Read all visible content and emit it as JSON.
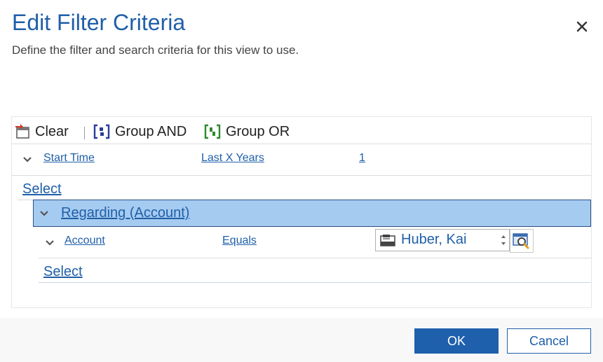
{
  "dialog": {
    "title": "Edit Filter Criteria",
    "subtitle": "Define the filter and search criteria for this view to use.",
    "close_icon": "close-icon"
  },
  "toolbar": {
    "clear_label": "Clear",
    "group_and_label": "Group AND",
    "group_or_label": "Group OR"
  },
  "conditions": [
    {
      "field": "Start Time",
      "operator": "Last X Years",
      "value": "1"
    }
  ],
  "select_label": "Select",
  "group": {
    "label": "Regarding (Account)",
    "condition": {
      "field": "Account",
      "operator": "Equals",
      "value": "Huber, Kai"
    },
    "select_label": "Select"
  },
  "footer": {
    "ok_label": "OK",
    "cancel_label": "Cancel"
  },
  "colors": {
    "accent": "#1e60ac",
    "group_highlight": "#a6cbf0"
  }
}
